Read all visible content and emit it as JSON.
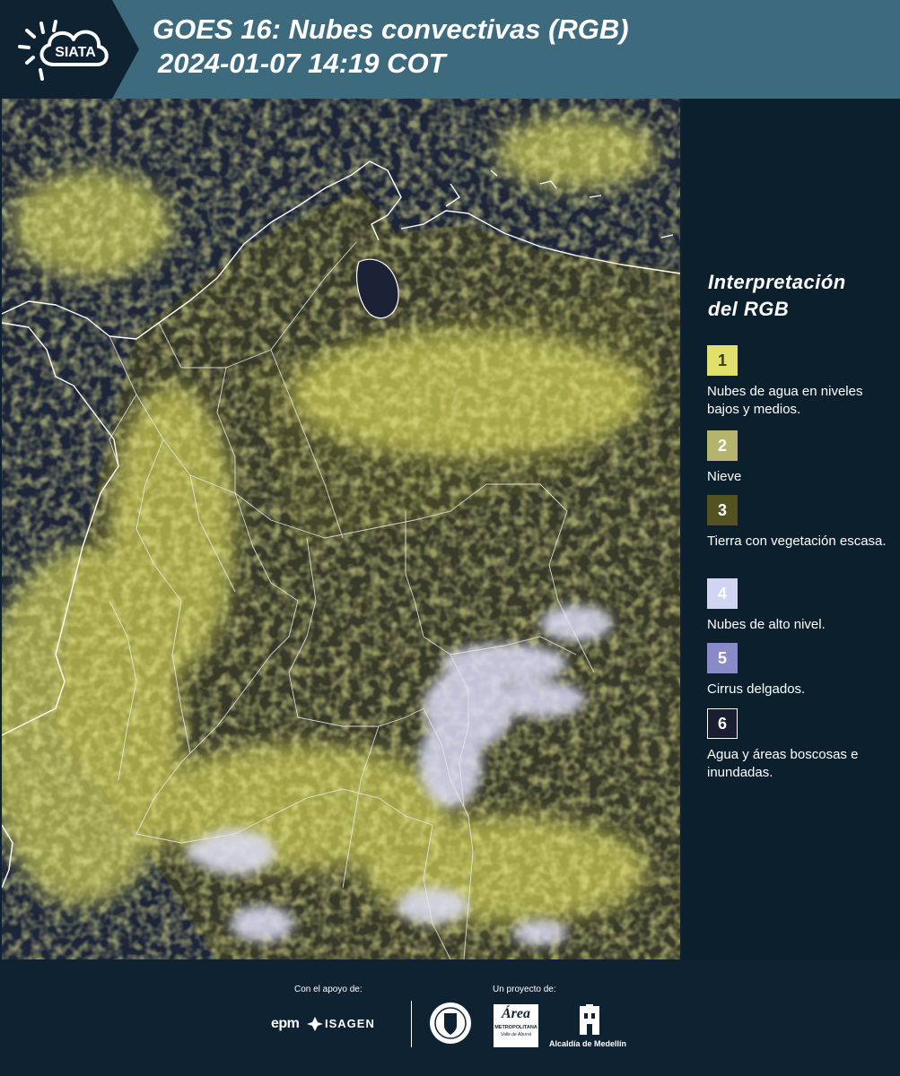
{
  "header": {
    "logo_text": "SIATA",
    "title_line1": "GOES 16: Nubes convectivas (RGB)",
    "title_line2": "2024-01-07 14:19 COT"
  },
  "legend": {
    "title_line1": "Interpretación",
    "title_line2": "del RGB",
    "items": [
      {
        "number": "1",
        "label": "Nubes de agua en niveles bajos y medios.",
        "color": "#e0e06a",
        "text_color": "#3a3a10"
      },
      {
        "number": "2",
        "label": "Nieve",
        "color": "#b4b46e",
        "text_color": "#ffffff"
      },
      {
        "number": "3",
        "label": "Tierra con vegetación escasa.",
        "color": "#525222",
        "text_color": "#ffffff"
      },
      {
        "number": "4",
        "label": "Nubes de alto nivel.",
        "color": "#d2d4f4",
        "text_color": "#ffffff"
      },
      {
        "number": "5",
        "label": "Cirrus delgados.",
        "color": "#8a8ac8",
        "text_color": "#ffffff"
      },
      {
        "number": "6",
        "label": "Agua y áreas boscosas e inundadas.",
        "color": "#191e32",
        "text_color": "#ffffff"
      }
    ]
  },
  "footer": {
    "support_label": "Con el apoyo de:",
    "project_label": "Un proyecto de:",
    "sponsor1": "epm",
    "sponsor2": "ISAGEN",
    "partner_area": "Área",
    "partner_area_sub": "METROPOLITANA",
    "partner_area_sub2": "Valle de Aburrá",
    "partner_alcaldia": "Alcaldía de Medellín"
  },
  "colors": {
    "header_bg": "#3e6a7e",
    "panel_bg": "#0b1f2d",
    "ocean": "#1c2438",
    "low_cloud": "#e0e06a",
    "high_cloud": "#d8daf4"
  }
}
